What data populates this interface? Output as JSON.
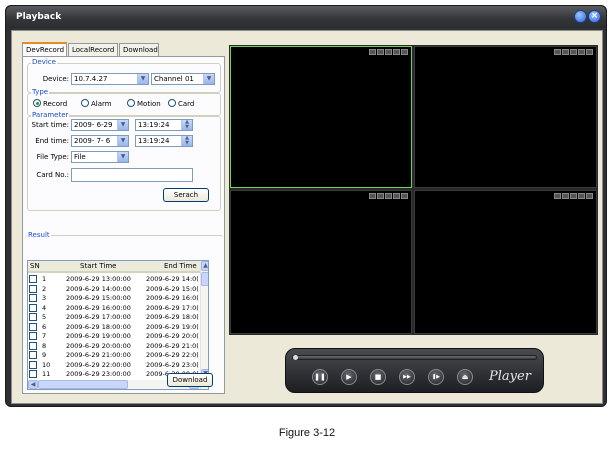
{
  "window": {
    "title": "Playback",
    "close_glyph": "×"
  },
  "tabs": [
    "DevRecord",
    "LocalRecord",
    "Download"
  ],
  "device": {
    "group_label": "Device",
    "device_label": "Device:",
    "device_value": "10.7.4.27",
    "channel_value": "Channel 01"
  },
  "type": {
    "group_label": "Type",
    "options": [
      "Record",
      "Alarm",
      "Motion",
      "Card"
    ],
    "selected": "Record"
  },
  "parameter": {
    "group_label": "Parameter",
    "start_label": "Start time:",
    "start_date": "2009- 6-29",
    "start_time": "13:19:24",
    "end_label": "End time:",
    "end_date": "2009- 7- 6",
    "end_time": "13:19:24",
    "filetype_label": "File Type:",
    "filetype_value": "File",
    "cardno_label": "Card No.:",
    "cardno_value": ""
  },
  "search_button": "Serach",
  "result": {
    "group_label": "Result",
    "columns": [
      "SN",
      "Start Time",
      "End Time"
    ],
    "rows": [
      {
        "sn": "1",
        "start": "2009-6-29 13:00:00",
        "end": "2009-6-29 14:0("
      },
      {
        "sn": "2",
        "start": "2009-6-29 14:00:00",
        "end": "2009-6-29 15:0("
      },
      {
        "sn": "3",
        "start": "2009-6-29 15:00:00",
        "end": "2009-6-29 16:0("
      },
      {
        "sn": "4",
        "start": "2009-6-29 16:00:00",
        "end": "2009-6-29 17:0("
      },
      {
        "sn": "5",
        "start": "2009-6-29 17:00:00",
        "end": "2009-6-29 18:0("
      },
      {
        "sn": "6",
        "start": "2009-6-29 18:00:00",
        "end": "2009-6-29 19:0("
      },
      {
        "sn": "7",
        "start": "2009-6-29 19:00:00",
        "end": "2009-6-29 20:0("
      },
      {
        "sn": "8",
        "start": "2009-6-29 20:00:00",
        "end": "2009-6-29 21:0("
      },
      {
        "sn": "9",
        "start": "2009-6-29 21:00:00",
        "end": "2009-6-29 22:0("
      },
      {
        "sn": "10",
        "start": "2009-6-29 22:00:00",
        "end": "2009-6-29 23:0("
      },
      {
        "sn": "11",
        "start": "2009-6-29 23:00:00",
        "end": "2009-6-30 00:0("
      }
    ]
  },
  "download_button": "Download",
  "player": {
    "logo": "Player",
    "buttons": [
      {
        "name": "pause",
        "glyph": "❚❚"
      },
      {
        "name": "play",
        "glyph": "▶"
      },
      {
        "name": "stop",
        "glyph": "■"
      },
      {
        "name": "fast-forward",
        "glyph": "▶▶"
      },
      {
        "name": "step",
        "glyph": "❚▶"
      },
      {
        "name": "eject",
        "glyph": "⏏"
      }
    ]
  },
  "caption": "Figure 3-12",
  "colors": {
    "selected_window_border": "#6fd05a",
    "group_label": "#1c50c8",
    "tab_accent": "#e68b2c"
  }
}
